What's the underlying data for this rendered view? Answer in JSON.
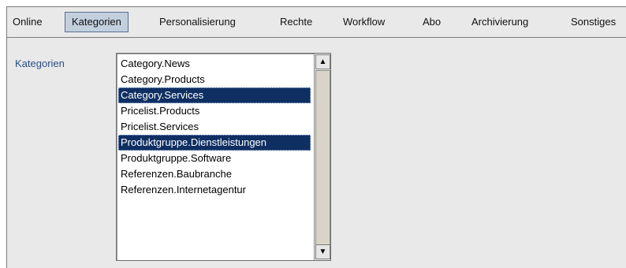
{
  "tabs": [
    {
      "label": "Online"
    },
    {
      "label": "Kategorien",
      "active": true
    },
    {
      "label": "Personalisierung"
    },
    {
      "label": "Rechte"
    },
    {
      "label": "Workflow"
    },
    {
      "label": "Abo"
    },
    {
      "label": "Archivierung"
    },
    {
      "label": "Sonstiges"
    }
  ],
  "categories_field": {
    "label": "Kategorien",
    "items": [
      {
        "text": "Category.News",
        "selected": false
      },
      {
        "text": "Category.Products",
        "selected": false
      },
      {
        "text": "Category.Services",
        "selected": true
      },
      {
        "text": "Pricelist.Products",
        "selected": false
      },
      {
        "text": "Pricelist.Services",
        "selected": false
      },
      {
        "text": "Produktgruppe.Dienstleistungen",
        "selected": true
      },
      {
        "text": "Produktgruppe.Software",
        "selected": false
      },
      {
        "text": "Referenzen.Baubranche",
        "selected": false
      },
      {
        "text": "Referenzen.Internetagentur",
        "selected": false
      }
    ]
  },
  "icons": {
    "scroll_up": "arrow-up-icon",
    "scroll_down": "arrow-down-icon"
  },
  "colors": {
    "active_tab_bg": "#c2cfdd",
    "selection_bg": "#0f2f62",
    "label_color": "#2a4e86"
  }
}
